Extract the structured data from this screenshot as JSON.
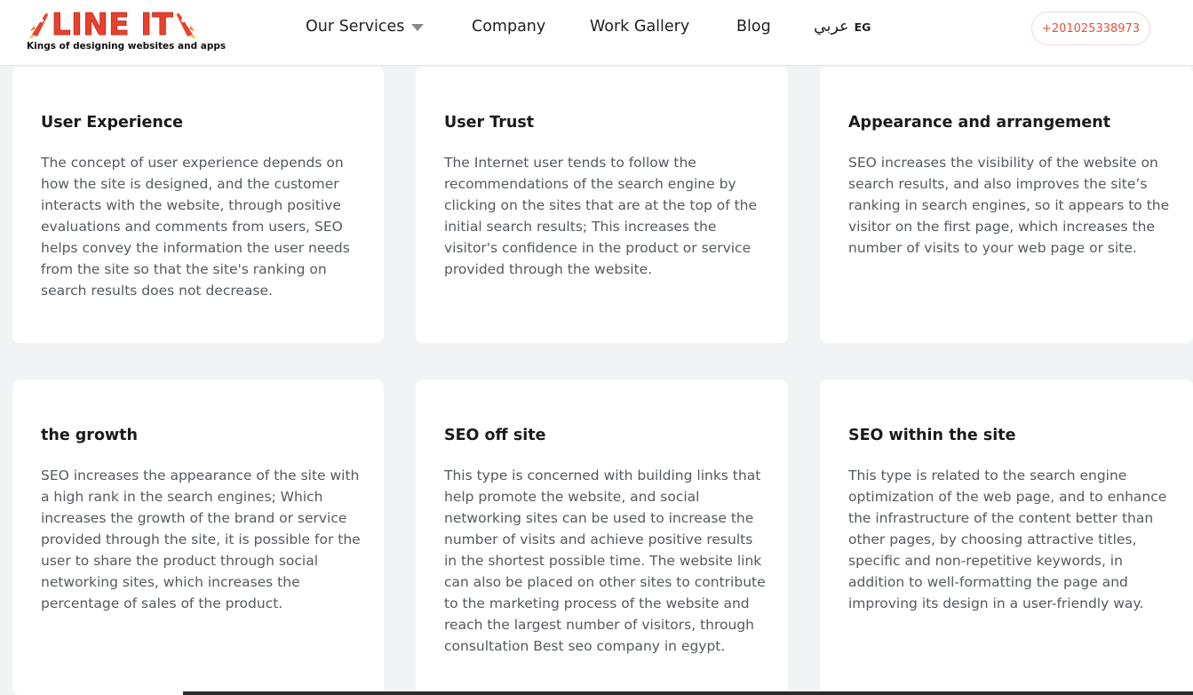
{
  "header": {
    "logo": {
      "text": "LINE IT",
      "tagline": "Kings of designing websites and apps"
    },
    "nav": [
      {
        "label": "Our Services",
        "has_dropdown": true
      },
      {
        "label": "Company"
      },
      {
        "label": "Work Gallery"
      },
      {
        "label": "Blog"
      }
    ],
    "language": {
      "label": "عربي",
      "code": "EG"
    },
    "phone": "+201025338973"
  },
  "cards": [
    {
      "title": "User Experience",
      "text": "The concept of user experience depends on how the site is designed, and the customer interacts with the website, through positive evaluations and comments from users, SEO helps convey the information the user needs from the site so that the site's ranking on search results does not decrease."
    },
    {
      "title": "User Trust",
      "text": "The Internet user tends to follow the recommendations of the search engine by clicking on the sites that are at the top of the initial search results; This increases the visitor's confidence in the product or service provided through the website."
    },
    {
      "title": "Appearance and arrangement",
      "text": "SEO increases the visibility of the website on search results, and also improves the site’s ranking in search engines, so it appears to the visitor on the first page, which increases the number of visits to your web page or site."
    },
    {
      "title": "the growth",
      "text": "SEO increases the appearance of the site with a high rank in the search engines; Which increases the growth of the brand or service provided through the site, it is possible for the user to share the product through social networking sites, which increases the percentage of sales of the product."
    },
    {
      "title": "SEO off site",
      "text": "This type is concerned with building links that help promote the website, and social networking sites can be used to increase the number of visits and achieve positive results in the shortest possible time. The website link can also be placed on other sites to contribute to the marketing process of the website and reach the largest number of visitors, through consultation Best seo company in egypt."
    },
    {
      "title": "SEO within the site",
      "text": "This type is related to the search engine optimization of the web page, and to enhance the infrastructure of the content better than other pages, by choosing attractive titles, specific and non-repetitive keywords, in addition to well-formatting the page and improving its design in a user-friendly way."
    }
  ],
  "colors": {
    "brand": "#e8412c",
    "page_bg": "#f2f3f5",
    "card_bg": "#ffffff",
    "body_text": "#555a5f",
    "phone_text": "#e5533d"
  }
}
